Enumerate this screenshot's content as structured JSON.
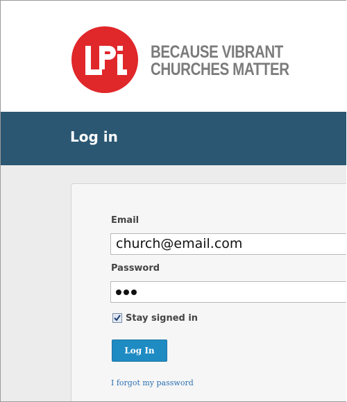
{
  "brand": {
    "logo_text": "LPi",
    "tagline_line1": "BECAUSE VIBRANT",
    "tagline_line2": "CHURCHES MATTER",
    "logo_color": "#e0272a",
    "tagline_color": "#7b7b7b"
  },
  "title_bar": {
    "title": "Log in",
    "background": "#2b5772"
  },
  "form": {
    "email_label": "Email",
    "email_value": "church@email.com",
    "password_label": "Password",
    "password_masked_count": 3,
    "stay_signed_in_label": "Stay signed in",
    "stay_signed_in_checked": true,
    "login_button_label": "Log In",
    "forgot_password_link": "I forgot my password",
    "button_color": "#1f8bc3",
    "link_color": "#2a6fb1"
  }
}
